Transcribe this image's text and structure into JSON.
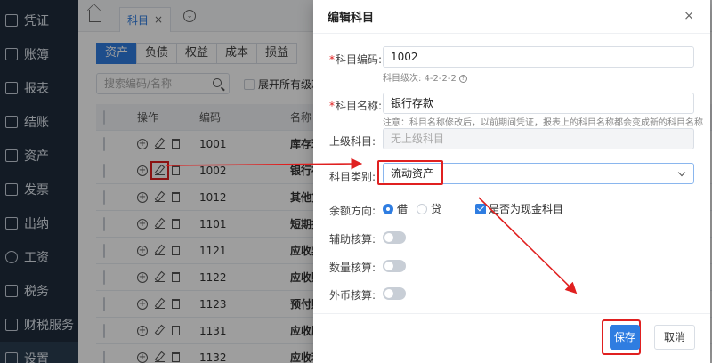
{
  "sidebar": {
    "items": [
      {
        "label": "凭证"
      },
      {
        "label": "账簿"
      },
      {
        "label": "报表"
      },
      {
        "label": "结账"
      },
      {
        "label": "资产"
      },
      {
        "label": "发票"
      },
      {
        "label": "出纳"
      },
      {
        "label": "工资"
      },
      {
        "label": "税务"
      },
      {
        "label": "财税服务"
      },
      {
        "label": "设置"
      }
    ]
  },
  "page_tab": {
    "label": "科目",
    "close": "×"
  },
  "category_tabs": [
    "资产",
    "负债",
    "权益",
    "成本",
    "损益"
  ],
  "search": {
    "placeholder": "搜索编码/名称"
  },
  "expand_label": "展开所有级次",
  "table": {
    "headers": {
      "op": "操作",
      "code": "编码",
      "name": "名称"
    },
    "rows": [
      {
        "code": "1001",
        "name": "库存现"
      },
      {
        "code": "1002",
        "name": "银行存"
      },
      {
        "code": "1012",
        "name": "其他货"
      },
      {
        "code": "1101",
        "name": "短期投"
      },
      {
        "code": "1121",
        "name": "应收票"
      },
      {
        "code": "1122",
        "name": "应收账"
      },
      {
        "code": "1123",
        "name": "预付账"
      },
      {
        "code": "1131",
        "name": "应收股"
      },
      {
        "code": "1132",
        "name": "应收利"
      }
    ]
  },
  "dialog": {
    "title": "编辑科目",
    "close": "×",
    "code_label": "科目编码:",
    "code_value": "1002",
    "level_hint": "科目级次: 4-2-2-2",
    "name_label": "科目名称:",
    "name_value": "银行存款",
    "name_hint": "注意：科目名称修改后，以前期间凭证，报表上的科目名称都会变成新的科目名称",
    "parent_label": "上级科目:",
    "parent_placeholder": "无上级科目",
    "category_label": "科目类别:",
    "category_value": "流动资产",
    "direction_label": "余额方向:",
    "direction_debit": "借",
    "direction_credit": "贷",
    "cash_label": "是否为现金科目",
    "aux_label": "辅助核算:",
    "qty_label": "数量核算:",
    "fx_label": "外币核算:",
    "save": "保存",
    "cancel": "取消"
  },
  "colors": {
    "accent": "#2f7de1",
    "annotation": "#e02020"
  }
}
